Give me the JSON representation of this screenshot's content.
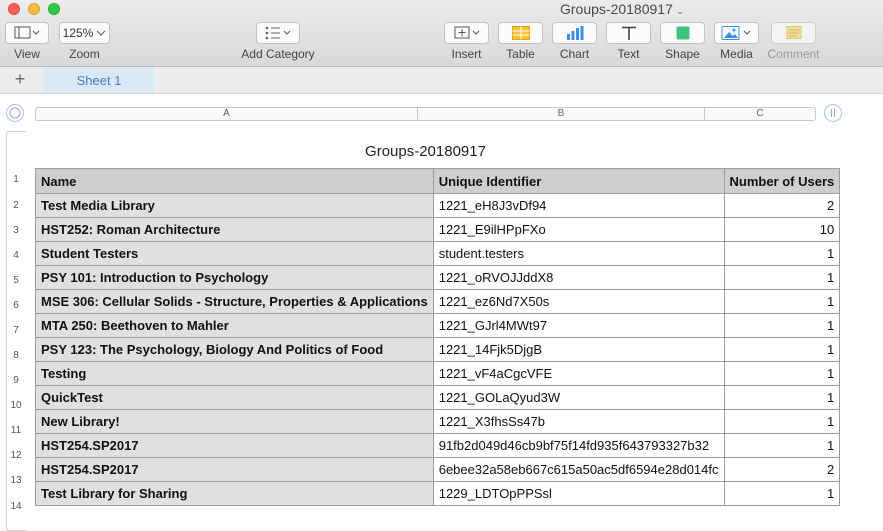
{
  "window": {
    "title": "Groups-20180917"
  },
  "toolbar": {
    "view_label": "View",
    "zoom_value": "125%",
    "zoom_label": "Zoom",
    "add_category_label": "Add Category",
    "insert_label": "Insert",
    "table_label": "Table",
    "chart_label": "Chart",
    "text_label": "Text",
    "shape_label": "Shape",
    "media_label": "Media",
    "comment_label": "Comment"
  },
  "tabs": {
    "add": "+",
    "sheet1": "Sheet 1"
  },
  "columns": [
    "A",
    "B",
    "C"
  ],
  "table": {
    "title": "Groups-20180917",
    "headers": [
      "Name",
      "Unique Identifier",
      "Number of Users"
    ],
    "rows": [
      [
        "Test Media Library",
        "1221_eH8J3vDf94",
        "2"
      ],
      [
        "HST252: Roman Architecture",
        "1221_E9ilHPpFXo",
        "10"
      ],
      [
        "Student Testers",
        "student.testers",
        "1"
      ],
      [
        "PSY 101: Introduction to Psychology",
        "1221_oRVOJJddX8",
        "1"
      ],
      [
        "MSE 306: Cellular Solids - Structure, Properties & Applications",
        "1221_ez6Nd7X50s",
        "1"
      ],
      [
        "MTA 250: Beethoven to Mahler",
        "1221_GJrl4MWt97",
        "1"
      ],
      [
        "PSY 123: The Psychology, Biology And Politics of Food",
        "1221_14Fjk5DjgB",
        "1"
      ],
      [
        "Testing",
        "1221_vF4aCgcVFE",
        "1"
      ],
      [
        "QuickTest",
        "1221_GOLaQyud3W",
        "1"
      ],
      [
        "New Library!",
        "1221_X3fhsSs47b",
        "1"
      ],
      [
        "HST254.SP2017",
        "91fb2d049d46cb9bf75f14fd935f643793327b32",
        "1"
      ],
      [
        "HST254.SP2017",
        "6ebee32a58eb667c615a50ac5df6594e28d014fc",
        "2"
      ],
      [
        "Test Library for Sharing",
        "1229_LDTOpPPSsl",
        "1"
      ]
    ]
  },
  "row_numbers": [
    "1",
    "2",
    "3",
    "4",
    "5",
    "6",
    "7",
    "8",
    "9",
    "10",
    "11",
    "12",
    "13",
    "14"
  ]
}
